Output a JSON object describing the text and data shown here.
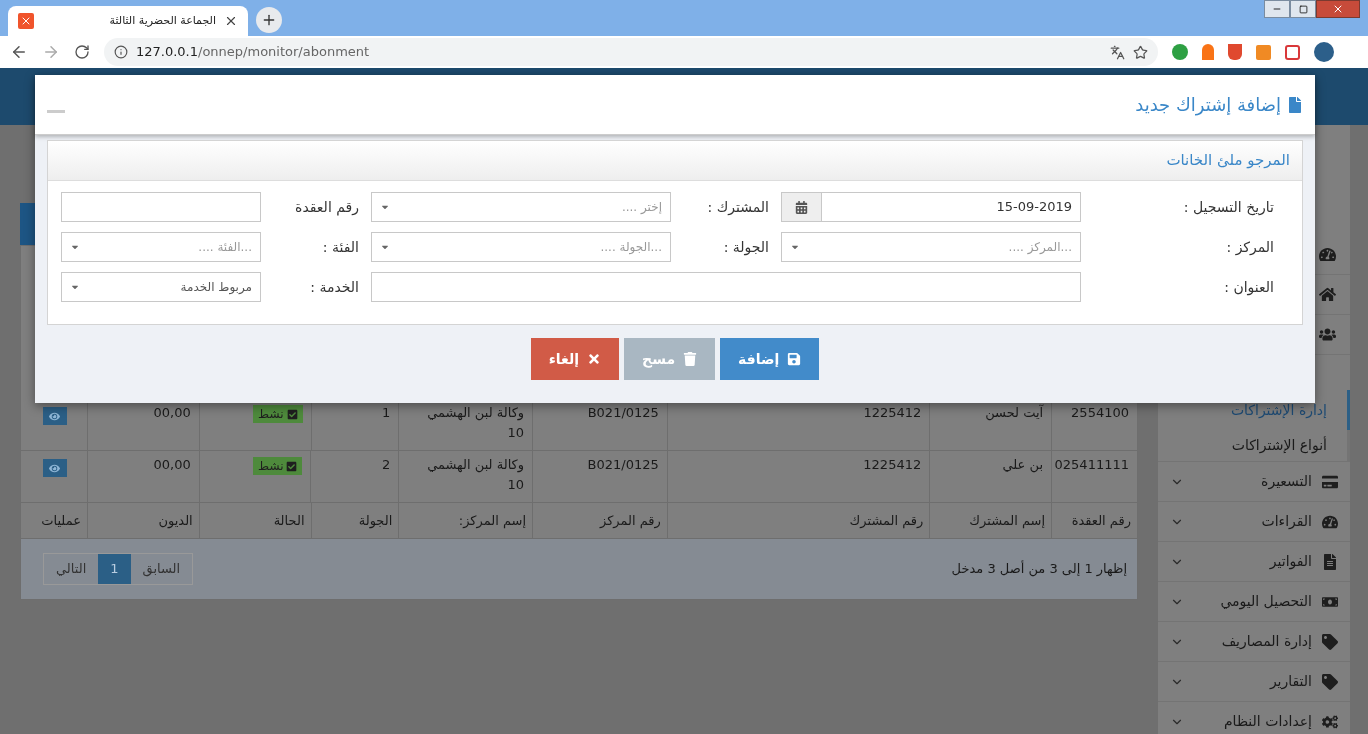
{
  "browser": {
    "tab_title": "الجماعة الحضرية الثالثة",
    "url_host": "127.0.0.1",
    "url_path": "/onnep/monitor/abonment"
  },
  "table": {
    "rows": [
      {
        "cells": [
          "2554100",
          "آيت لحسن",
          "1225412",
          "B021/0125",
          "وكالة لبن الهشمي 10",
          "1"
        ],
        "status": {
          "label": "نشط",
          "active": true
        },
        "debt": "00,00"
      },
      {
        "cells": [
          "025411111",
          "بن علي",
          "1225412",
          "B021/0125",
          "وكالة لبن الهشمي 10",
          "2"
        ],
        "status": {
          "label": "نشط",
          "active": true
        },
        "debt": "00,00"
      }
    ],
    "footer_columns": [
      "رقم العقدة",
      "إسم المشترك",
      "رقم المشترك",
      "رقم المركز",
      "إسم المركز:",
      "الجولة",
      "الحالة",
      "الديون",
      "عمليات"
    ]
  },
  "pagination": {
    "info": "إظهار 1 إلى 3 من أصل 3 مدخل",
    "pages": [
      {
        "label": "السابق",
        "selected": false
      },
      {
        "label": "1",
        "selected": true
      },
      {
        "label": "التالي",
        "selected": false
      }
    ]
  },
  "sidebar": {
    "items": [
      {
        "kind": "icon"
      },
      {
        "kind": "icon"
      },
      {
        "kind": "icon"
      },
      {
        "kind": "hidden"
      },
      {
        "kind": "sub",
        "label": "إدارة الإشتراكات",
        "selected": true
      },
      {
        "kind": "sub",
        "label": "أنواع الإشتراكات",
        "selected": false
      },
      {
        "kind": "menu",
        "label": "التسعيرة",
        "expanded": false
      },
      {
        "kind": "menu",
        "label": "القراءات",
        "expanded": false
      },
      {
        "kind": "menu",
        "label": "الفواتير",
        "expanded": false
      },
      {
        "kind": "menu",
        "label": "التحصيل اليومي",
        "expanded": false
      },
      {
        "kind": "menu",
        "label": "إدارة المصاريف",
        "expanded": false
      },
      {
        "kind": "menu",
        "label": "التقارير",
        "expanded": false
      },
      {
        "kind": "menu",
        "label": "إعدادات النظام",
        "expanded": false
      }
    ]
  },
  "modal": {
    "title": "إضافة إشتراك جديد",
    "panel_title": "المرجو ملئ الخانات",
    "fields": [
      {
        "label": "تاريخ التسجيل :",
        "kind": "date",
        "value": "15-09-2019"
      },
      {
        "label": "المشترك :",
        "kind": "select",
        "placeholder": "إختر ...."
      },
      {
        "label": "رقم العقدة",
        "kind": "text"
      },
      {
        "label": "المركز :",
        "kind": "select",
        "placeholder": "...المركز ...."
      },
      {
        "label": "الجولة :",
        "kind": "select",
        "placeholder": "...الجولة ...."
      },
      {
        "label": "الفئة :",
        "kind": "select",
        "placeholder": "...الفئة ...."
      },
      {
        "label": "العنوان :",
        "kind": "wide_text"
      },
      {
        "label": "الخدمة :",
        "kind": "select",
        "value": "مربوط الخدمة"
      }
    ],
    "buttons": [
      {
        "kind": "save",
        "label": "إضافة",
        "disabled": false
      },
      {
        "kind": "clear",
        "label": "مسح",
        "disabled": true
      },
      {
        "kind": "cancel",
        "label": "إلغاء",
        "disabled": false
      }
    ]
  }
}
